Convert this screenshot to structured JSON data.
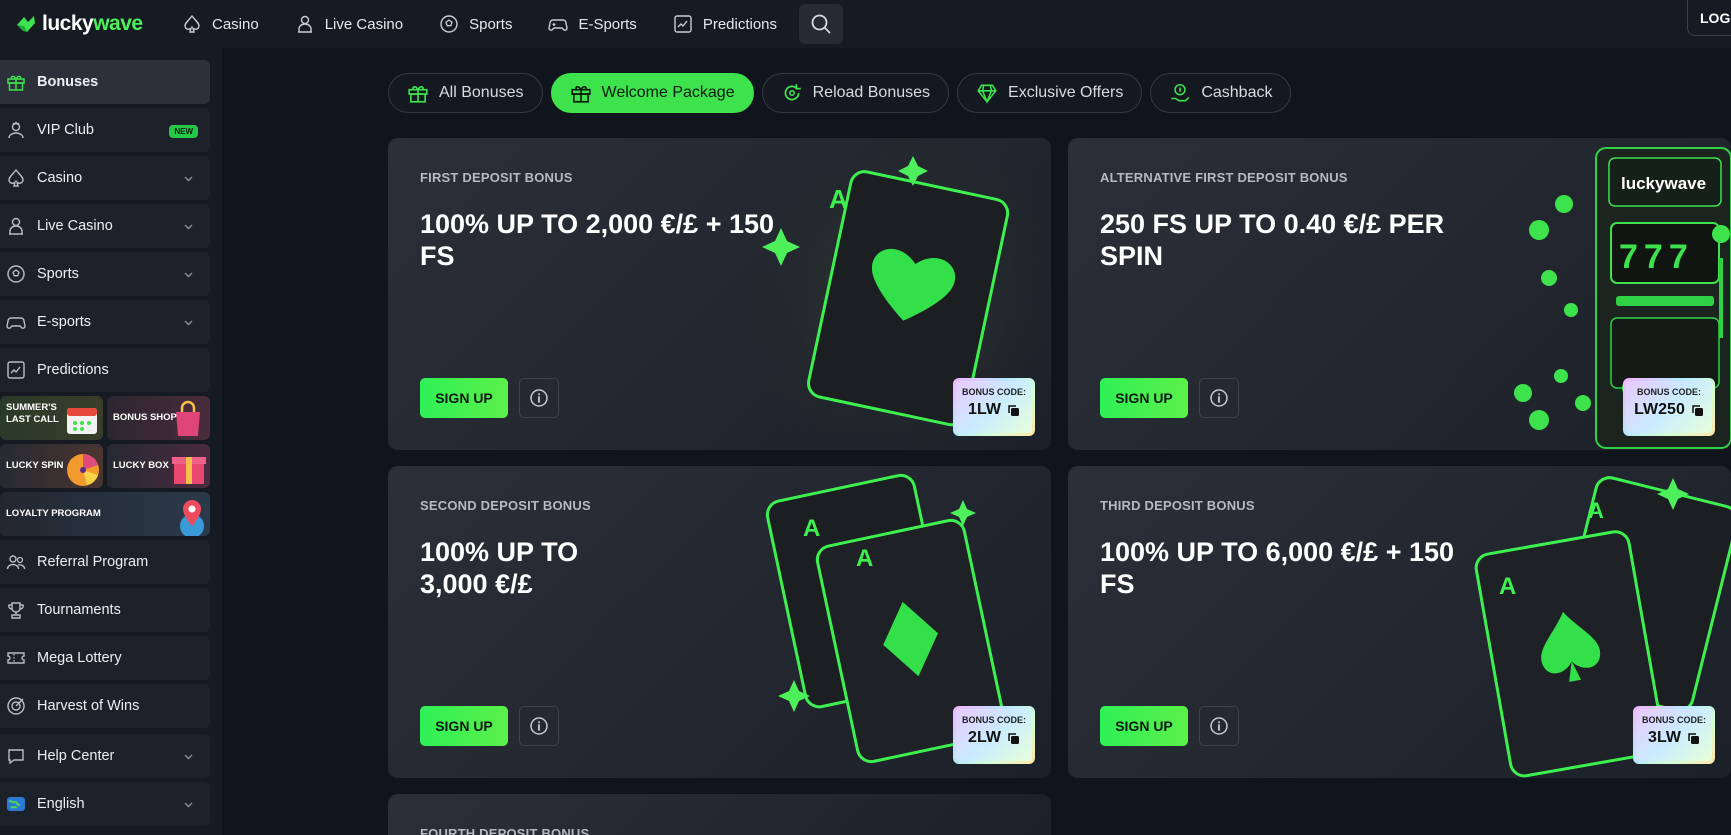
{
  "brand": {
    "logo_lucky": "lucky",
    "logo_wave": "wave"
  },
  "topnav": {
    "items": [
      {
        "label": "Casino",
        "icon": "spade-icon"
      },
      {
        "label": "Live Casino",
        "icon": "dealer-icon"
      },
      {
        "label": "Sports",
        "icon": "soccer-ball-icon"
      },
      {
        "label": "E-Sports",
        "icon": "gamepad-icon"
      },
      {
        "label": "Predictions",
        "icon": "chart-icon"
      }
    ],
    "login_label": "LOG"
  },
  "sidebar": {
    "items": [
      {
        "label": "Bonuses",
        "icon": "gift-icon"
      },
      {
        "label": "VIP Club",
        "icon": "user-crown-icon",
        "badge": "NEW"
      },
      {
        "label": "Casino",
        "icon": "spade-icon"
      },
      {
        "label": "Live Casino",
        "icon": "dealer-icon"
      },
      {
        "label": "Sports",
        "icon": "soccer-ball-icon"
      },
      {
        "label": "E-sports",
        "icon": "gamepad-icon"
      },
      {
        "label": "Predictions",
        "icon": "chart-icon"
      }
    ],
    "promos": [
      {
        "label": "SUMMER'S LAST CALL"
      },
      {
        "label": "BONUS SHOP"
      },
      {
        "label": "LUCKY SPIN"
      },
      {
        "label": "LUCKY BOX"
      },
      {
        "label": "LOYALTY PROGRAM"
      }
    ],
    "lower_items": [
      {
        "label": "Referral Program",
        "icon": "users-icon"
      },
      {
        "label": "Tournaments",
        "icon": "trophy-icon"
      },
      {
        "label": "Mega Lottery",
        "icon": "ticket-icon"
      },
      {
        "label": "Harvest of Wins",
        "icon": "target-icon"
      },
      {
        "label": "Help Center",
        "icon": "chat-icon"
      },
      {
        "label": "English",
        "icon": "globe-icon"
      }
    ]
  },
  "tabs": [
    {
      "label": "All Bonuses",
      "icon": "gift-icon"
    },
    {
      "label": "Welcome Package",
      "icon": "gift-icon",
      "active": true
    },
    {
      "label": "Reload Bonuses",
      "icon": "reload-icon"
    },
    {
      "label": "Exclusive Offers",
      "icon": "diamond-icon"
    },
    {
      "label": "Cashback",
      "icon": "cashback-icon"
    }
  ],
  "cards": [
    {
      "subtitle": "FIRST DEPOSIT BONUS",
      "title": "100% UP TO 2,000 €/£ + 150 FS",
      "button": "SIGN UP",
      "code_label": "BONUS CODE:",
      "code": "1LW"
    },
    {
      "subtitle": "ALTERNATIVE FIRST DEPOSIT BONUS",
      "title": "250 FS UP TO 0.40 €/£ PER SPIN",
      "button": "SIGN UP",
      "code_label": "BONUS CODE:",
      "code": "LW250",
      "slot_brand": "luckywave",
      "slot_digits": "777"
    },
    {
      "subtitle": "SECOND DEPOSIT BONUS",
      "title": "100% UP TO 3,000 €/£",
      "button": "SIGN UP",
      "code_label": "BONUS CODE:",
      "code": "2LW"
    },
    {
      "subtitle": "THIRD DEPOSIT BONUS",
      "title": "100% UP TO 6,000 €/£ + 150 FS",
      "button": "SIGN UP",
      "code_label": "BONUS CODE:",
      "code": "3LW"
    },
    {
      "subtitle": "FOURTH DEPOSIT BONUS"
    }
  ],
  "card_art": {
    "ace_letter": "A"
  },
  "colors": {
    "accent": "#3de24d",
    "background": "#10141c",
    "panel": "#161a22"
  }
}
